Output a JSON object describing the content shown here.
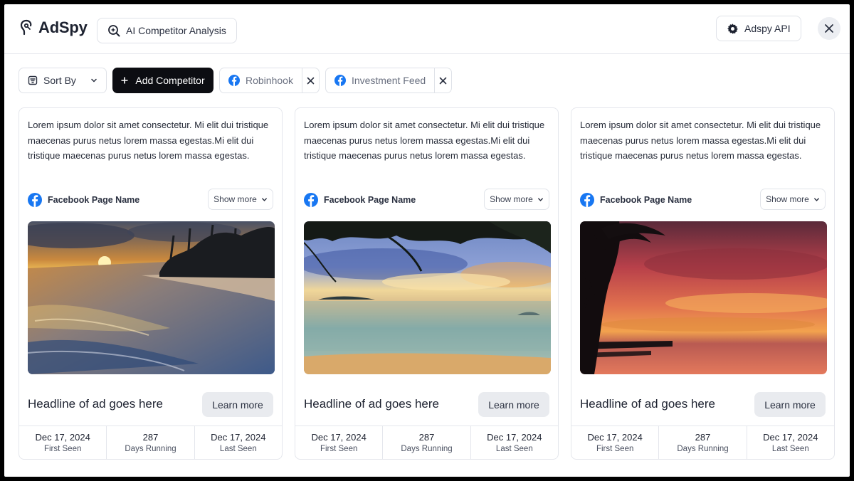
{
  "header": {
    "brand": "AdSpy",
    "ai_button": "AI Competitor Analysis",
    "api_button": "Adspy API"
  },
  "filters": {
    "sort_label": "Sort By",
    "add_competitor": "Add Competitor",
    "chips": [
      "Robinhook",
      "Investment Feed"
    ]
  },
  "colors": {
    "accent_dark": "#0c0d12",
    "facebook_blue": "#1877f2"
  },
  "cards": [
    {
      "body": "Lorem ipsum dolor sit amet consectetur. Mi elit dui tristique maecenas purus netus lorem massa egestas.Mi elit dui tristique maecenas purus netus lorem massa egestas.",
      "page_name": "Facebook Page Name",
      "show_more": "Show more",
      "headline": "Headline of ad goes here",
      "cta": "Learn more",
      "first_seen": "Dec 17, 2024",
      "first_seen_label": "First Seen",
      "days_running": "287",
      "days_running_label": "Days Running",
      "last_seen": "Dec 17, 2024",
      "last_seen_label": "Last Seen"
    },
    {
      "body": "Lorem ipsum dolor sit amet consectetur. Mi elit dui tristique maecenas purus netus lorem massa egestas.Mi elit dui tristique maecenas purus netus lorem massa egestas.",
      "page_name": "Facebook Page Name",
      "show_more": "Show more",
      "headline": "Headline of ad goes here",
      "cta": "Learn more",
      "first_seen": "Dec 17, 2024",
      "first_seen_label": "First Seen",
      "days_running": "287",
      "days_running_label": "Days Running",
      "last_seen": "Dec 17, 2024",
      "last_seen_label": "Last Seen"
    },
    {
      "body": "Lorem ipsum dolor sit amet consectetur. Mi elit dui tristique maecenas purus netus lorem massa egestas.Mi elit dui tristique maecenas purus netus lorem massa egestas.",
      "page_name": "Facebook Page Name",
      "show_more": "Show more",
      "headline": "Headline of ad goes here",
      "cta": "Learn more",
      "first_seen": "Dec 17, 2024",
      "first_seen_label": "First Seen",
      "days_running": "287",
      "days_running_label": "Days Running",
      "last_seen": "Dec 17, 2024",
      "last_seen_label": "Last Seen"
    }
  ]
}
